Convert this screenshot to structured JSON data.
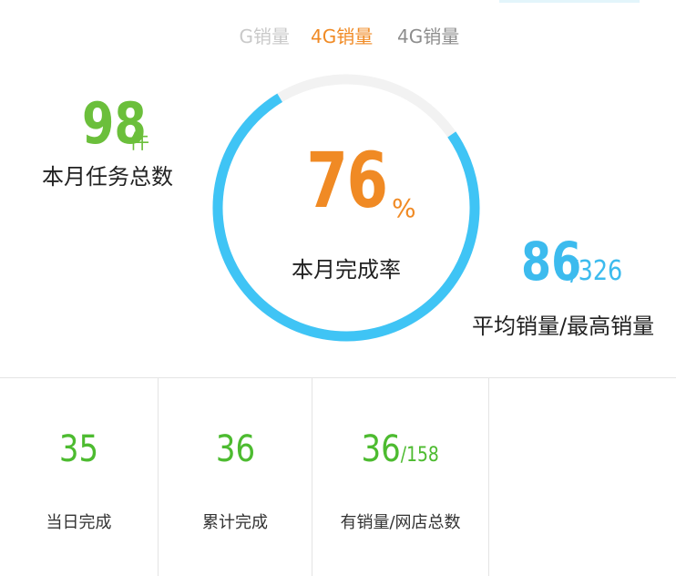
{
  "tabs": [
    {
      "label": "3G销量",
      "visible_part": "G销量"
    },
    {
      "label": "4G销量"
    },
    {
      "label": "4G销量"
    }
  ],
  "gauge": {
    "rate_value": "76",
    "rate_unit": "%",
    "rate_label": "本月完成率",
    "progress": 0.76,
    "progress_color": "#3fc4f5",
    "track_color": "#f2f2f2"
  },
  "task_total": {
    "value": "98",
    "unit": "件",
    "label": "本月任务总数",
    "color": "#6bbf3b"
  },
  "sales_avg": {
    "average": "86",
    "max": "/326",
    "label": "平均销量/最高销量",
    "color": "#3cbbee"
  },
  "stats": [
    {
      "value": "35",
      "value_small": "",
      "label": "当日完成"
    },
    {
      "value": "36",
      "value_small": "",
      "label": "累计完成"
    },
    {
      "value": "36",
      "value_small": "/158",
      "label": "有销量/网店总数"
    },
    {
      "value": "",
      "value_small": "",
      "label": ""
    }
  ],
  "colors": {
    "accent_orange": "#f08a24",
    "accent_green": "#4dbb30",
    "accent_blue": "#3cbbee"
  }
}
